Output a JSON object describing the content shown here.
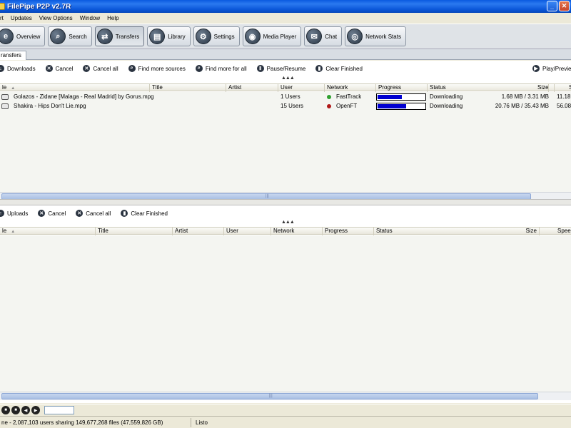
{
  "window": {
    "title": "FilePipe P2P v2.7R",
    "minimize": "_",
    "close": "✕"
  },
  "menu": [
    "rt",
    "Updates",
    "View Options",
    "Window",
    "Help"
  ],
  "toolbar": [
    {
      "label": "Overview",
      "icon": "e",
      "icon_name": "overview-icon"
    },
    {
      "label": "Search",
      "icon": "⌕",
      "icon_name": "search-icon"
    },
    {
      "label": "Transfers",
      "icon": "⇄",
      "icon_name": "transfers-icon"
    },
    {
      "label": "Library",
      "icon": "▤",
      "icon_name": "library-icon"
    },
    {
      "label": "Settings",
      "icon": "⚙",
      "icon_name": "settings-icon"
    },
    {
      "label": "Media Player",
      "icon": "◉",
      "icon_name": "media-player-icon"
    },
    {
      "label": "Chat",
      "icon": "✉",
      "icon_name": "chat-icon"
    },
    {
      "label": "Network Stats",
      "icon": "◎",
      "icon_name": "network-stats-icon"
    }
  ],
  "tab": {
    "label": "ransfers"
  },
  "downloads": {
    "actions": {
      "downloads": "Downloads",
      "cancel": "Cancel",
      "cancel_all": "Cancel all",
      "find_more_sources": "Find more sources",
      "find_more_for_all": "Find more for all",
      "pause_resume": "Pause/Resume",
      "clear_finished": "Clear Finished",
      "play_preview": "Play/Previe"
    },
    "columns": [
      "le",
      "Title",
      "Artist",
      "User",
      "Network",
      "Progress",
      "Status",
      "Size",
      "S"
    ],
    "rows": [
      {
        "file": "Golazos - Zidane [Malaga - Real Madrid] by Gorus.mpg",
        "user": "1 Users",
        "network": "FastTrack",
        "network_color": "#2fa02f",
        "progress": 0.5,
        "status": "Downloading",
        "size": "1.68 MB / 3.31 MB",
        "speed": "11.18"
      },
      {
        "file": "Shakira - Hips Don't Lie.mpg",
        "user": "15 Users",
        "network": "OpenFT",
        "network_color": "#b01818",
        "progress": 0.59,
        "status": "Downloading",
        "size": "20.76 MB / 35.43 MB",
        "speed": "56.08"
      }
    ]
  },
  "uploads": {
    "actions": {
      "uploads": "Uploads",
      "cancel": "Cancel",
      "cancel_all": "Cancel all",
      "clear_finished": "Clear Finished"
    },
    "columns": [
      "le",
      "Title",
      "Artist",
      "User",
      "Network",
      "Progress",
      "Status",
      "Size",
      "Speed"
    ]
  },
  "statusbar": {
    "left": "ne - 2,087,103  users sharing 149,677,268  files (47,559,826  GB)",
    "right": "Listo"
  }
}
